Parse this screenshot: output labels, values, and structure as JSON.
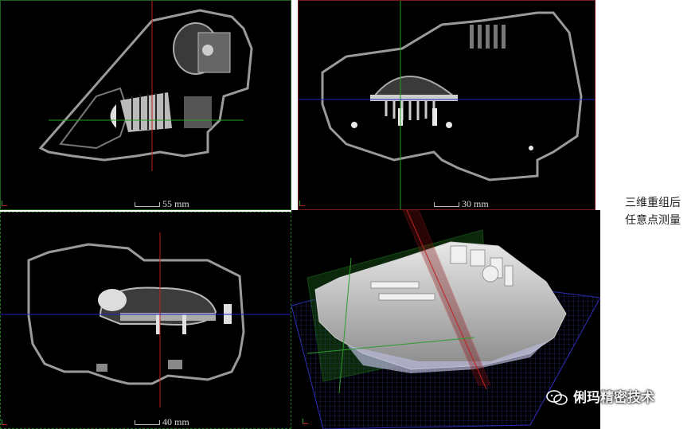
{
  "views": {
    "top_left": {
      "scale_label": "55 mm"
    },
    "top_right": {
      "scale_label": "30 mm"
    },
    "bottom_left": {
      "scale_label": "40 mm"
    }
  },
  "caption": {
    "line1": "三维重组后",
    "line2": "任意点测量"
  },
  "watermark": {
    "text": "俐玛精密技术",
    "icon": "wechat-icon"
  },
  "colors": {
    "crosshair_red": "#c02020",
    "crosshair_green": "#1f9f1f",
    "crosshair_blue": "#2020c8",
    "background": "#000000"
  }
}
